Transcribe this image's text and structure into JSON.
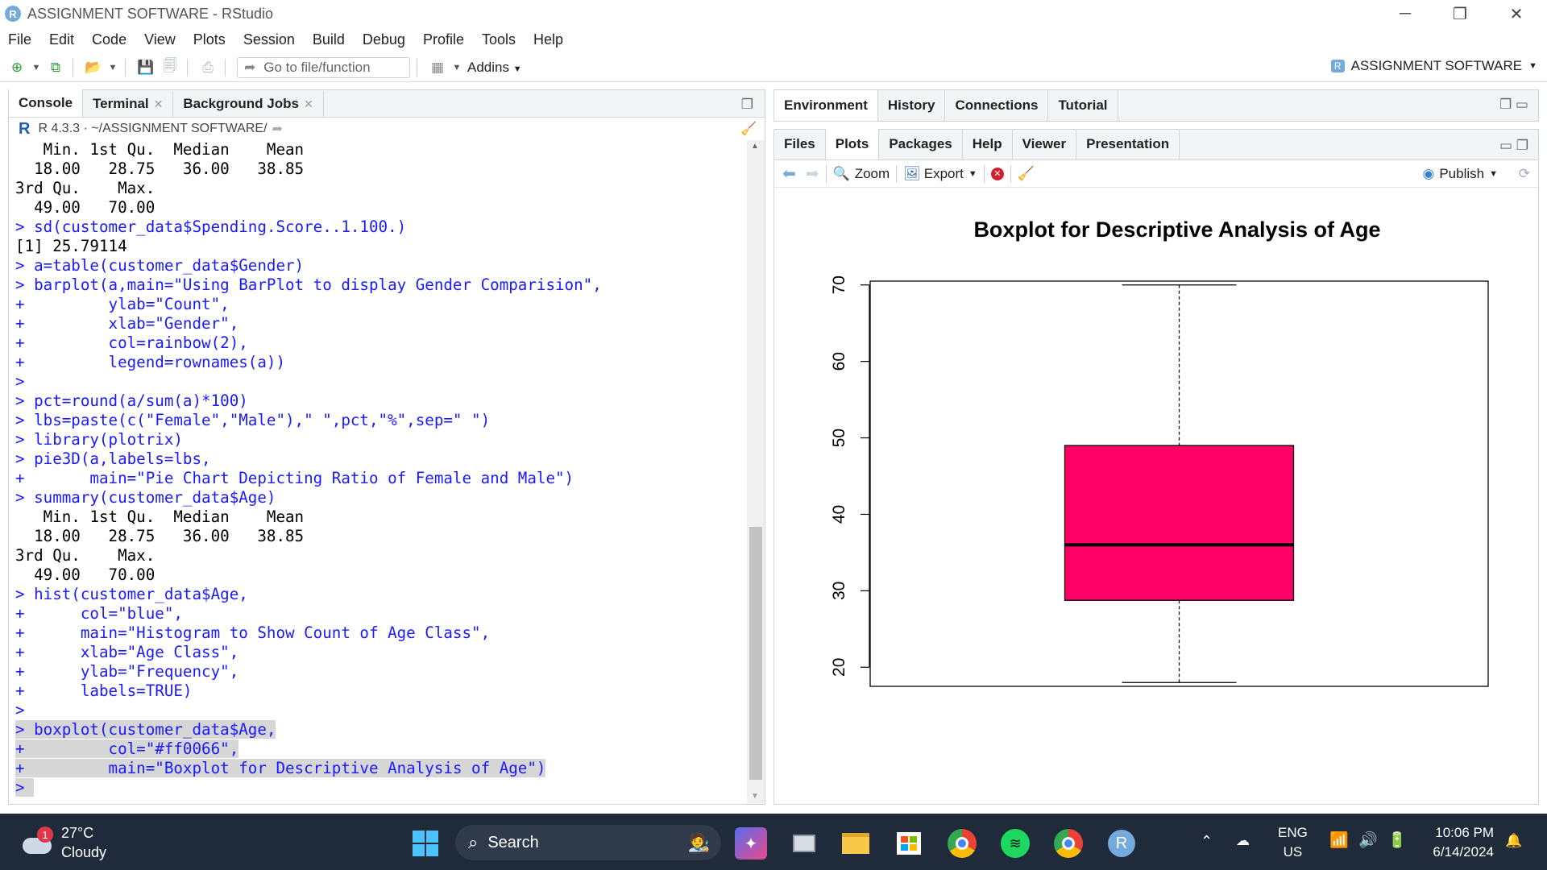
{
  "window": {
    "title": "ASSIGNMENT SOFTWARE - RStudio",
    "logo": "R",
    "min": "─",
    "restore": "❐",
    "close": "✕"
  },
  "menu": [
    "File",
    "Edit",
    "Code",
    "View",
    "Plots",
    "Session",
    "Build",
    "Debug",
    "Profile",
    "Tools",
    "Help"
  ],
  "toolbar": {
    "goto": "Go to file/function",
    "addins": "Addins",
    "project": "ASSIGNMENT SOFTWARE"
  },
  "left_tabs": [
    {
      "label": "Console"
    },
    {
      "label": "Terminal"
    },
    {
      "label": "Background Jobs"
    }
  ],
  "console_header": {
    "version": "R 4.3.3",
    "path": "· ~/ASSIGNMENT SOFTWARE/"
  },
  "console_lines": [
    {
      "t": "   Min. 1st Qu.  Median    Mean ",
      "c": "out"
    },
    {
      "t": "  18.00   28.75   36.00   38.85 ",
      "c": "out"
    },
    {
      "t": "3rd Qu.    Max. ",
      "c": "out"
    },
    {
      "t": "  49.00   70.00 ",
      "c": "out"
    },
    {
      "t": "> sd(customer_data$Spending.Score..1.100.)",
      "c": "cmd"
    },
    {
      "t": "[1] 25.79114",
      "c": "out"
    },
    {
      "t": "> a=table(customer_data$Gender)",
      "c": "cmd"
    },
    {
      "t": "> barplot(a,main=\"Using BarPlot to display Gender Comparision\",",
      "c": "cmd"
    },
    {
      "t": "+         ylab=\"Count\",",
      "c": "cmd"
    },
    {
      "t": "+         xlab=\"Gender\",",
      "c": "cmd"
    },
    {
      "t": "+         col=rainbow(2),",
      "c": "cmd"
    },
    {
      "t": "+         legend=rownames(a))",
      "c": "cmd"
    },
    {
      "t": "> ",
      "c": "cmd"
    },
    {
      "t": "> pct=round(a/sum(a)*100)",
      "c": "cmd"
    },
    {
      "t": "> lbs=paste(c(\"Female\",\"Male\"),\" \",pct,\"%\",sep=\" \")",
      "c": "cmd"
    },
    {
      "t": "> library(plotrix)",
      "c": "cmd"
    },
    {
      "t": "> pie3D(a,labels=lbs,",
      "c": "cmd"
    },
    {
      "t": "+       main=\"Pie Chart Depicting Ratio of Female and Male\")",
      "c": "cmd"
    },
    {
      "t": "> summary(customer_data$Age)",
      "c": "cmd"
    },
    {
      "t": "   Min. 1st Qu.  Median    Mean ",
      "c": "out"
    },
    {
      "t": "  18.00   28.75   36.00   38.85 ",
      "c": "out"
    },
    {
      "t": "3rd Qu.    Max. ",
      "c": "out"
    },
    {
      "t": "  49.00   70.00 ",
      "c": "out"
    },
    {
      "t": "> hist(customer_data$Age,",
      "c": "cmd"
    },
    {
      "t": "+      col=\"blue\",",
      "c": "cmd"
    },
    {
      "t": "+      main=\"Histogram to Show Count of Age Class\",",
      "c": "cmd"
    },
    {
      "t": "+      xlab=\"Age Class\",",
      "c": "cmd"
    },
    {
      "t": "+      ylab=\"Frequency\",",
      "c": "cmd"
    },
    {
      "t": "+      labels=TRUE)",
      "c": "cmd"
    },
    {
      "t": "> ",
      "c": "cmd"
    },
    {
      "t": "> boxplot(customer_data$Age,",
      "c": "cmd sel"
    },
    {
      "t": "+         col=\"#ff0066\",",
      "c": "cmd sel"
    },
    {
      "t": "+         main=\"Boxplot for Descriptive Analysis of Age\")",
      "c": "cmd sel"
    },
    {
      "t": "> ",
      "c": "cmd sel"
    }
  ],
  "right_top_tabs": [
    {
      "label": "Environment"
    },
    {
      "label": "History"
    },
    {
      "label": "Connections"
    },
    {
      "label": "Tutorial"
    }
  ],
  "right_bottom_tabs": [
    {
      "label": "Files"
    },
    {
      "label": "Plots"
    },
    {
      "label": "Packages"
    },
    {
      "label": "Help"
    },
    {
      "label": "Viewer"
    },
    {
      "label": "Presentation"
    }
  ],
  "plot_toolbar": {
    "zoom": "Zoom",
    "export": "Export",
    "publish": "Publish"
  },
  "chart_data": {
    "type": "boxplot",
    "title": "Boxplot for Descriptive Analysis of Age",
    "xlabel": "",
    "ylabel": "",
    "ylim": [
      17.5,
      70.5
    ],
    "yticks": [
      20,
      30,
      40,
      50,
      60,
      70
    ],
    "color": "#ff0066",
    "series": [
      {
        "min": 18,
        "q1": 28.75,
        "median": 36,
        "q3": 49,
        "max": 70
      }
    ]
  },
  "taskbar": {
    "temp": "27°C",
    "weather": "Cloudy",
    "weather_badge": "1",
    "search": "Search",
    "lang1": "ENG",
    "lang2": "US",
    "time": "10:06 PM",
    "date": "6/14/2024",
    "rapp": "R"
  }
}
